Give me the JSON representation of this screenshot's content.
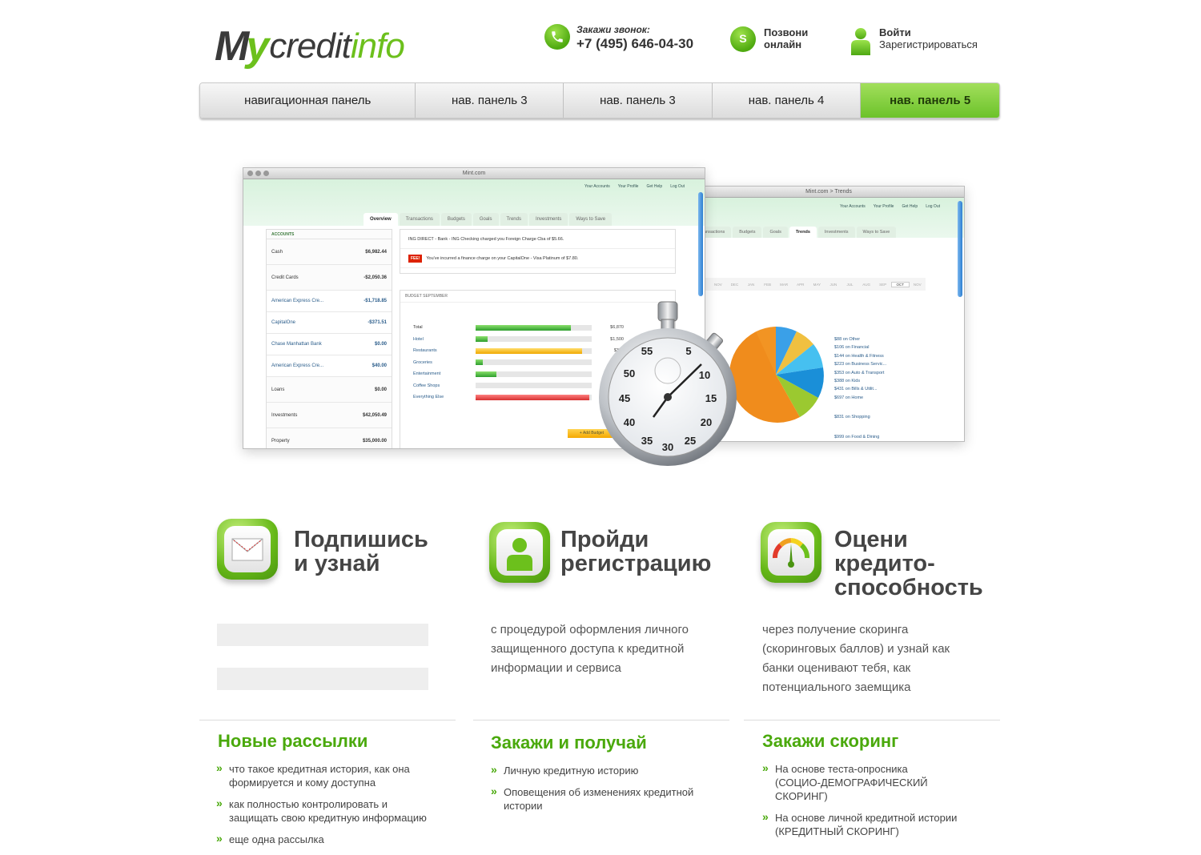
{
  "brand": {
    "my": "My",
    "credit": "credit",
    "info": "info"
  },
  "header": {
    "phone_label": "Закажи звонок:",
    "phone_number": "+7 (495) 646-04-30",
    "skype_line1": "Позвони",
    "skype_line2": "онлайн",
    "login": "Войти",
    "register": "Зарегистрироваться"
  },
  "nav": [
    "навигационная панель",
    "нав. панель 3",
    "нав. панель 3",
    "нав. панель 4",
    "нав. панель 5"
  ],
  "hero": {
    "window1_title": "Mint.com",
    "window1_links": [
      "Your Accounts",
      "Your Profile",
      "Get Help",
      "Log Out"
    ],
    "window1_tabs": [
      "Overview",
      "Transactions",
      "Budgets",
      "Goals",
      "Trends",
      "Investments",
      "Ways to Save"
    ],
    "accounts_head": "ACCOUNTS",
    "accounts": [
      {
        "name": "Cash",
        "amount": "$6,982.44"
      },
      {
        "name": "Credit Cards",
        "amount": "-$2,050.36"
      },
      {
        "name": "American Express Cre...",
        "amount": "-$1,718.85",
        "sub": true
      },
      {
        "name": "CapitalOne",
        "amount": "-$371.51",
        "sub": true
      },
      {
        "name": "Chase Manhattan Bank",
        "amount": "$0.00",
        "sub": true
      },
      {
        "name": "American Express Cre...",
        "amount": "$40.00",
        "sub": true
      },
      {
        "name": "Loans",
        "amount": "$0.00"
      },
      {
        "name": "Investments",
        "amount": "$42,050.49"
      },
      {
        "name": "Property",
        "amount": "$35,000.00"
      }
    ],
    "alert1": "ING DIRECT - Bank - ING Checking charged you Foreign Charge Cba of $5.66.",
    "alert2_badge": "FEE!",
    "alert2": "You've incurred a finance charge on your CapitalOne - Visa Platinum of $7.80.",
    "budget_head": "BUDGET SEPTEMBER",
    "budget_rows": [
      {
        "label": "Total",
        "amount": "$6,870",
        "fill": 0.82,
        "color": "green"
      },
      {
        "label": "Hotel",
        "amount": "$1,500",
        "fill": 0.1,
        "color": "green"
      },
      {
        "label": "Restaurants",
        "amount": "$350",
        "fill": 0.92,
        "color": "orange"
      },
      {
        "label": "Groceries",
        "amount": "",
        "fill": 0.06,
        "color": "green"
      },
      {
        "label": "Entertainment",
        "amount": "",
        "fill": 0.18,
        "color": "green"
      },
      {
        "label": "Coffee Shops",
        "amount": "",
        "fill": 0.0,
        "color": "green"
      },
      {
        "label": "Everything Else",
        "amount": "",
        "fill": 0.98,
        "color": "red"
      }
    ],
    "add_budget": "+ Add Budget",
    "window2_title": "Mint.com > Trends",
    "window2_tabs": [
      "Transactions",
      "Budgets",
      "Goals",
      "Trends",
      "Investments",
      "Ways to Save"
    ],
    "months": [
      "OCT",
      "NOV",
      "DEC",
      "JAN",
      "FEB",
      "MAR",
      "APR",
      "MAY",
      "JUN",
      "JUL",
      "AUG",
      "SEP",
      "OCT",
      "NOV"
    ],
    "pie_legend": [
      "$88 on Other",
      "$106 on Financial",
      "$144 on Health & Fitness",
      "$223 on Business Servic...",
      "$353 on Auto & Transport",
      "$388 on Kids",
      "$431 on Bills & Utilit...",
      "$697 on Home",
      "$831 on Shopping",
      "$999 on Food & Dining"
    ],
    "stopwatch_numbers": [
      "55",
      "5",
      "50",
      "10",
      "45",
      "15",
      "40",
      "20",
      "35",
      "25",
      "30"
    ]
  },
  "features": [
    {
      "title_line1": "Подпишись",
      "title_line2": "и узнай",
      "title_line3": ""
    },
    {
      "title_line1": "Пройди",
      "title_line2": "регистрацию",
      "title_line3": ""
    },
    {
      "title_line1": "Оцени",
      "title_line2": "кредито-",
      "title_line3": "способность"
    }
  ],
  "feature_text": {
    "col2": [
      "с процедурой оформления личного",
      "защищенного доступа к кредитной",
      "информации и сервиса"
    ],
    "col3": [
      "через получение скоринга",
      "(скоринговых баллов) и узнай как",
      "банки оценивают тебя, как",
      "потенциального заемщика"
    ]
  },
  "sections": [
    {
      "title": "Новые рассылки",
      "items": [
        [
          "что такое кредитная история, как она",
          "формируется и кому доступна"
        ],
        [
          "как полностью контролировать и",
          "защищать свою кредитную информацию"
        ],
        [
          "еще одна рассылка"
        ]
      ]
    },
    {
      "title": "Закажи и получай",
      "items": [
        [
          "Личную кредитную историю"
        ],
        [
          "Оповещения об изменениях кредитной",
          "истории"
        ]
      ]
    },
    {
      "title": "Закажи скоринг",
      "items": [
        [
          "На основе теста-опросника",
          "(СОЦИО-ДЕМОГРАФИЧЕСКИЙ",
          "СКОРИНГ)"
        ],
        [
          "На основе личной кредитной истории",
          "(КРЕДИТНЫЙ СКОРИНГ)"
        ]
      ]
    }
  ],
  "colors": {
    "brand_green": "#6cc01c",
    "title_green": "#4aa90c",
    "text_dark": "#333333"
  }
}
